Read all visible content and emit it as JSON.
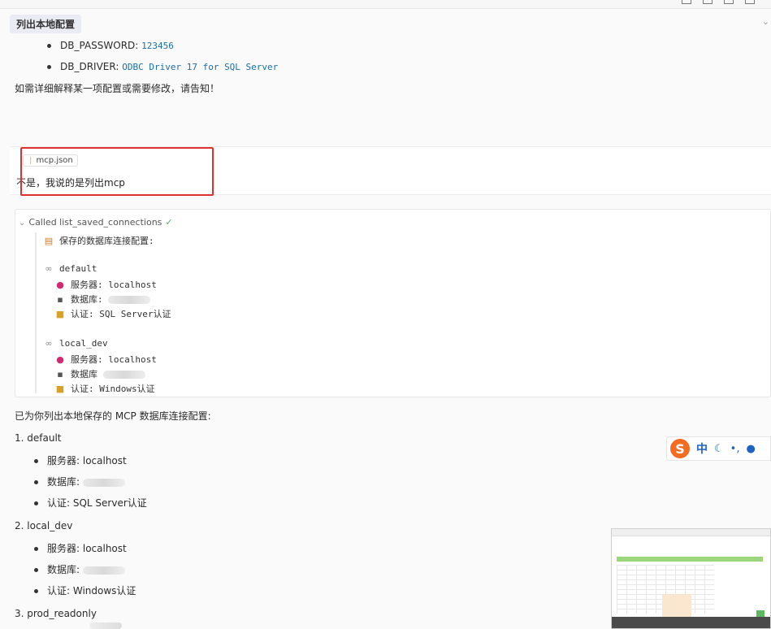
{
  "header": {
    "chip": "列出本地配置"
  },
  "env_items": [
    {
      "key": "DB_PASSWORD:",
      "value": "123456"
    },
    {
      "key": "DB_DRIVER:",
      "value": "ODBC Driver 17 for SQL Server"
    }
  ],
  "note": "如需详细解释某一项配置或需要修改，请告知！",
  "user_message": {
    "file_chip": "mcp.json",
    "text": "不是，我说的是列出mcp"
  },
  "tool_call": {
    "header": "Called list_saved_connections",
    "title": "保存的数据库连接配置:",
    "connections": [
      {
        "name": "default",
        "server": "服务器: localhost",
        "database": "数据库:",
        "auth": "认证: SQL Server认证"
      },
      {
        "name": "local_dev",
        "server": "服务器: localhost",
        "database": "数据库",
        "auth": "认证: Windows认证"
      }
    ]
  },
  "summary": {
    "title": "已为你列出本地保存的 MCP 数据库连接配置:",
    "items": [
      {
        "head": "1. default",
        "lines": [
          "服务器: localhost",
          "数据库:",
          "认证: SQL Server认证"
        ]
      },
      {
        "head": "2. local_dev",
        "lines": [
          "服务器: localhost",
          "数据库:",
          "认证: Windows认证"
        ]
      },
      {
        "head": "3. prod_readonly",
        "lines": []
      }
    ]
  },
  "ime": {
    "logo": "S",
    "mode": "中"
  },
  "colors": {
    "highlight": "#e03030",
    "link": "#1a6fa8",
    "ime_brand": "#f36c21"
  }
}
